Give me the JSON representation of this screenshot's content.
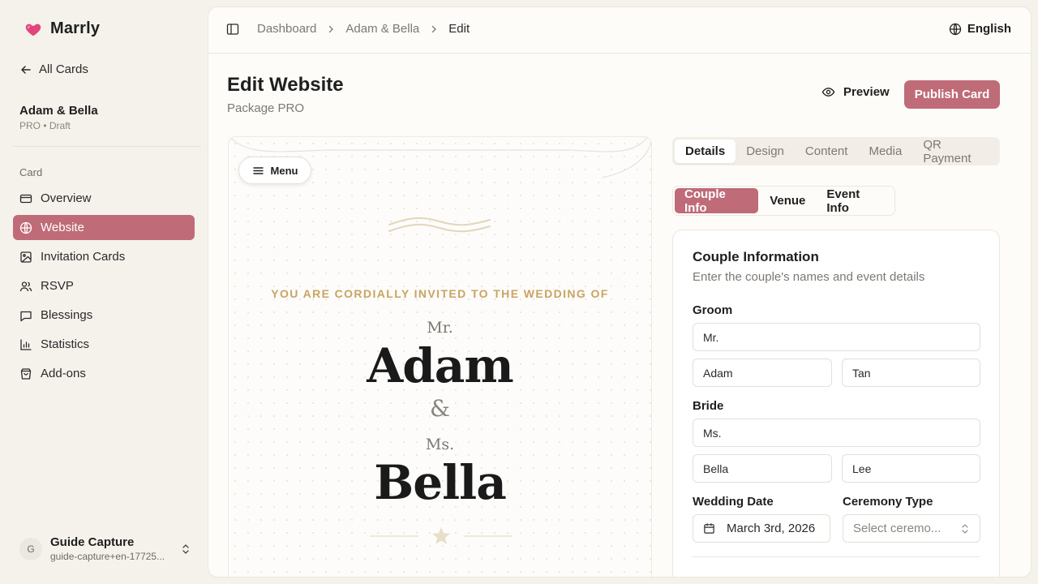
{
  "app": {
    "name": "Marrly",
    "accent": "#bf6b78",
    "heart_color": "#e2457a"
  },
  "sidebar": {
    "back_label": "All Cards",
    "card_title": "Adam & Bella",
    "card_status": "PRO • Draft",
    "section_label": "Card",
    "items": [
      {
        "label": "Overview",
        "icon": "credit-card-icon"
      },
      {
        "label": "Website",
        "icon": "globe-icon"
      },
      {
        "label": "Invitation Cards",
        "icon": "image-icon"
      },
      {
        "label": "RSVP",
        "icon": "users-icon"
      },
      {
        "label": "Blessings",
        "icon": "message-icon"
      },
      {
        "label": "Statistics",
        "icon": "bar-chart-icon"
      },
      {
        "label": "Add-ons",
        "icon": "shopping-bag-icon"
      }
    ],
    "active_index": 1,
    "user": {
      "initial": "G",
      "name": "Guide Capture",
      "email": "guide-capture+en-17725..."
    }
  },
  "header": {
    "breadcrumbs": [
      "Dashboard",
      "Adam & Bella",
      "Edit"
    ],
    "language": "English"
  },
  "page": {
    "title": "Edit Website",
    "subtitle": "Package PRO",
    "preview_label": "Preview",
    "publish_label": "Publish Card"
  },
  "preview": {
    "menu_label": "Menu",
    "invite_text": "YOU ARE CORDIALLY INVITED TO THE WEDDING OF",
    "groom_title": "Mr.",
    "groom_name": "Adam",
    "ampersand": "&",
    "bride_title": "Ms.",
    "bride_name": "Bella"
  },
  "editor": {
    "tabs": [
      "Details",
      "Design",
      "Content",
      "Media",
      "QR Payment"
    ],
    "active_tab": 0,
    "subtabs": [
      "Couple Info",
      "Venue",
      "Event Info"
    ],
    "active_subtab": 0,
    "card_title": "Couple Information",
    "card_desc": "Enter the couple's names and event details",
    "groom_label": "Groom",
    "groom_title_value": "Mr.",
    "groom_first": "Adam",
    "groom_last": "Tan",
    "bride_label": "Bride",
    "bride_title_value": "Ms.",
    "bride_first": "Bella",
    "bride_last": "Lee",
    "date_label": "Wedding Date",
    "date_value": "March 3rd, 2026",
    "ceremony_label": "Ceremony Type",
    "ceremony_placeholder": "Select ceremo..."
  }
}
